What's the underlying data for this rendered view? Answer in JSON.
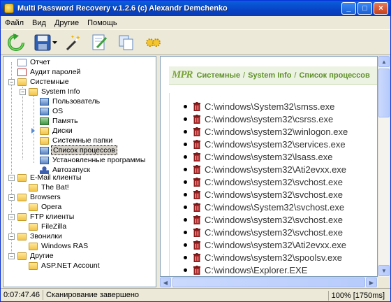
{
  "window": {
    "title": "Multi Password Recovery v.1.2.6 (c) Alexandr Demchenko",
    "minimize": "_",
    "maximize": "□",
    "close": "×"
  },
  "menu": [
    "Файл",
    "Вид",
    "Другие",
    "Помощь"
  ],
  "toolbar": {
    "icons": [
      "refresh-icon",
      "save-icon",
      "dropdown-arrow-icon",
      "magic-wand-icon",
      "edit-icon",
      "copy-icon",
      "settings-icon"
    ]
  },
  "tree": {
    "report": "Отчет",
    "password_audit": "Аудит паролей",
    "system": "Системные",
    "system_info": "System Info",
    "user": "Пользователь",
    "os": "OS",
    "memory": "Память",
    "disks": "Диски",
    "system_folders": "Системные папки",
    "process_list": "Список процессов",
    "installed_programs": "Установленные программы",
    "autorun": "Автозапуск",
    "email_clients": "E-Mail клиенты",
    "the_bat": "The Bat!",
    "browsers": "Browsers",
    "opera": "Opera",
    "ftp_clients": "FTP клиенты",
    "filezilla": "FileZilla",
    "dialers": "Звонилки",
    "windows_ras": "Windows RAS",
    "others": "Другие",
    "aspnet": "ASP.NET Account"
  },
  "content": {
    "logo": "MPR",
    "breadcrumb": [
      "Системные",
      "System Info",
      "Список процессов"
    ],
    "separator": "/",
    "processes": [
      "C:\\windows\\System32\\smss.exe",
      "C:\\windows\\system32\\csrss.exe",
      "C:\\windows\\system32\\winlogon.exe",
      "C:\\windows\\system32\\services.exe",
      "C:\\windows\\system32\\lsass.exe",
      "C:\\windows\\system32\\Ati2evxx.exe",
      "C:\\windows\\system32\\svchost.exe",
      "C:\\windows\\system32\\svchost.exe",
      "C:\\windows\\System32\\svchost.exe",
      "C:\\windows\\system32\\svchost.exe",
      "C:\\windows\\system32\\svchost.exe",
      "C:\\windows\\system32\\Ati2evxx.exe",
      "C:\\windows\\system32\\spoolsv.exe",
      "C:\\windows\\Explorer.EXE"
    ]
  },
  "status": {
    "time": "0:07:47.46",
    "message": "Сканирование завершено",
    "zoom": "100%",
    "duration": "[1750ms]"
  }
}
